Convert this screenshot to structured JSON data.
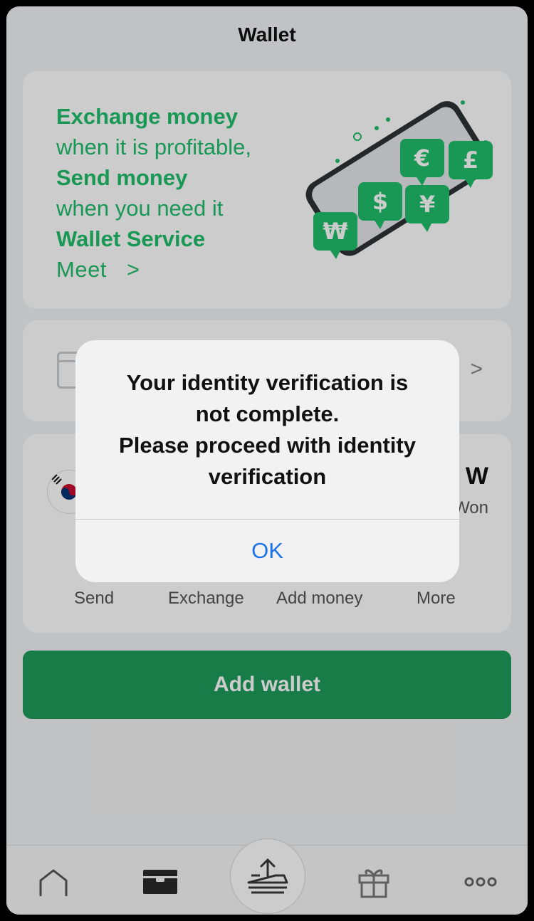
{
  "header": {
    "title": "Wallet"
  },
  "banner": {
    "line1": "Exchange money",
    "line2": "when it is profitable,",
    "line3": "Send money",
    "line4": "when you need it",
    "line5": "Wallet Service",
    "meet": "Meet",
    "meet_arrow": ">",
    "currency_symbols": [
      "₩",
      "$",
      "¥",
      "€",
      "£"
    ]
  },
  "row_card": {
    "arrow": ">"
  },
  "currency_card": {
    "amount_visible": "W",
    "currency_name_visible": "Won",
    "actions": [
      "Send",
      "Exchange",
      "Add money",
      "More"
    ]
  },
  "add_wallet_label": "Add wallet",
  "dialog": {
    "message": "Your identity verification is\nnot complete.\nPlease proceed with identity\nverification",
    "ok_label": "OK"
  },
  "tabbar": {
    "tabs": [
      "home-icon",
      "wallet-icon",
      "send-icon",
      "gift-icon",
      "more-icon"
    ]
  },
  "colors": {
    "brand_green": "#1fbe6a",
    "button_green": "#1d9c5b",
    "link_blue": "#1a73e8"
  }
}
